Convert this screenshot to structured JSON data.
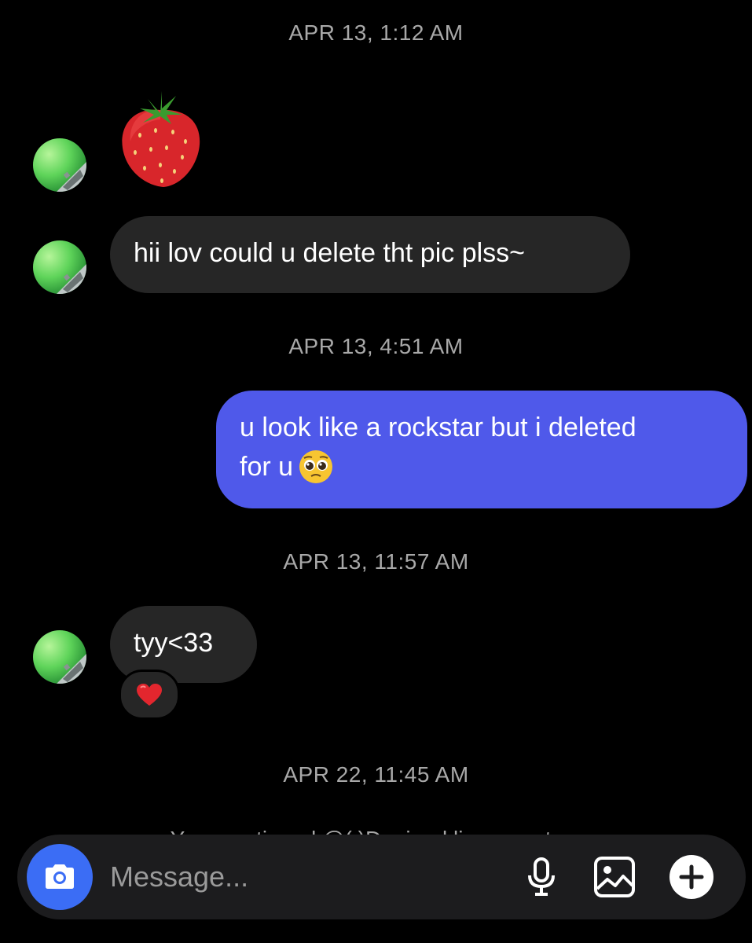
{
  "timestamps": {
    "t1": "APR 13, 1:12 AM",
    "t2": "APR 13, 4:51 AM",
    "t3": "APR 13, 11:57 AM",
    "t4": "APR 22, 11:45 AM"
  },
  "messages": [
    {
      "from": "them",
      "type": "emoji",
      "icon": "strawberry-emoji"
    },
    {
      "from": "them",
      "type": "text",
      "text": "hii lov could u delete tht pic plss~"
    },
    {
      "from": "me",
      "type": "text",
      "line1": "u look like a rockstar but i deleted",
      "line2": "for u",
      "icon": "pleading-face-emoji"
    },
    {
      "from": "them",
      "type": "text",
      "text": "tyy<33",
      "reaction_icon": "red-heart-emoji"
    }
  ],
  "partial_notice": "You mentioned @(.)Daniperl lissa on story",
  "composer": {
    "placeholder": "Message...",
    "icons": [
      "camera-icon",
      "microphone-icon",
      "gallery-icon",
      "plus-icon"
    ]
  },
  "colors": {
    "background": "#000000",
    "incoming_bubble": "#262626",
    "outgoing_bubble": "#4f59ea",
    "camera_button": "#3b6df5",
    "timestamp_text": "#a8a8a8"
  }
}
